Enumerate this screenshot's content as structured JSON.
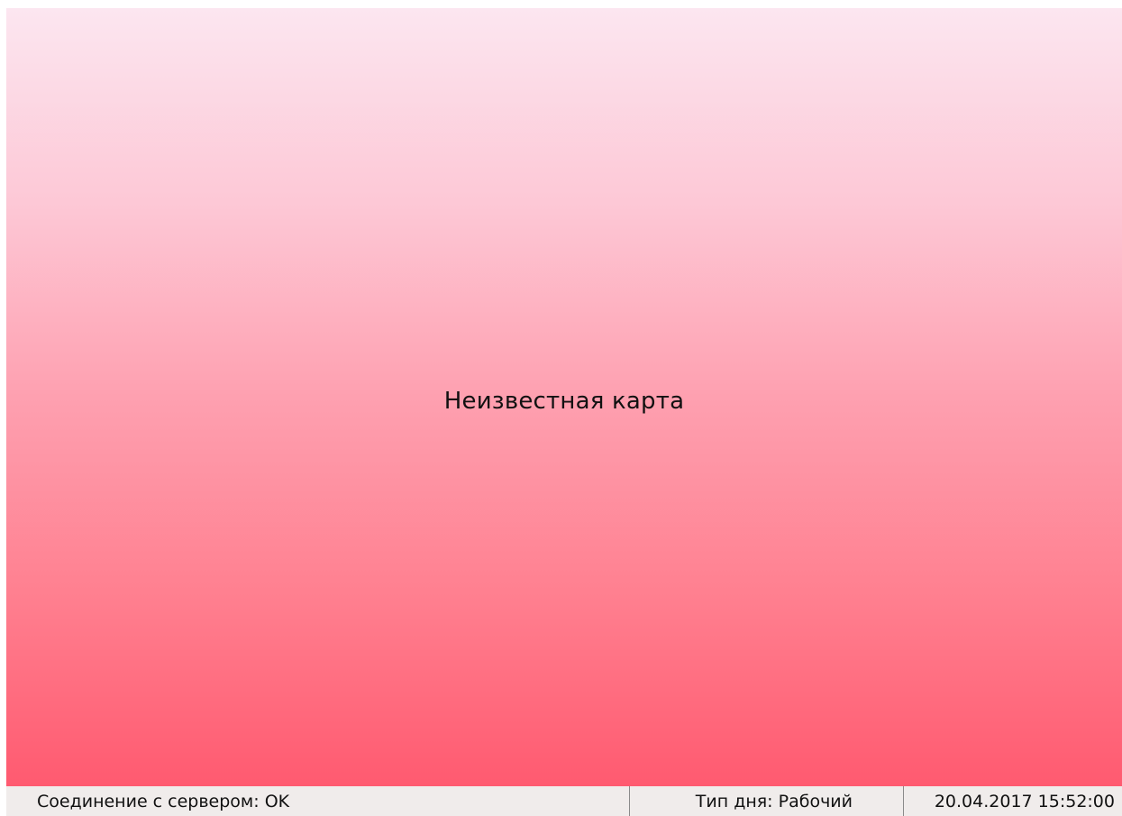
{
  "main": {
    "message": "Неизвестная карта"
  },
  "status_bar": {
    "connection": "Соединение с сервером: OK",
    "day_type": "Тип дня: Рабочий",
    "datetime": "20.04.2017 15:52:00"
  },
  "colors": {
    "gradient_top": "#fce6f0",
    "gradient_bottom": "#ff5a70",
    "status_bar_bg": "#f0eceb"
  }
}
